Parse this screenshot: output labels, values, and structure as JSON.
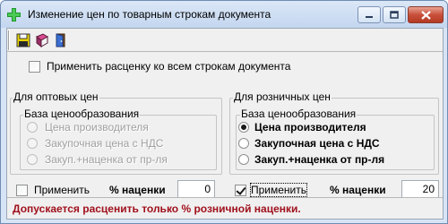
{
  "window": {
    "title": "Изменение цен по товарным строкам документа",
    "colors": {
      "close_button": "#c8503a",
      "status_text": "#a0101c"
    }
  },
  "toolbar": {
    "buttons": [
      {
        "icon": "save-icon"
      },
      {
        "icon": "book-icon"
      },
      {
        "icon": "exit-door-icon"
      }
    ]
  },
  "apply_all": {
    "label": "Применить расценку ко всем строкам документа",
    "checked": false
  },
  "wholesale": {
    "title": "Для оптовых цен",
    "base_title": "База ценообразования",
    "options": [
      "Цена производителя",
      "Закупочная цена с НДС",
      "Закуп.+наценка от пр-ля"
    ],
    "apply_label": "Применить",
    "apply_checked": false,
    "markup_label": "% наценки",
    "markup_value": "0"
  },
  "retail": {
    "title": "Для розничных цен",
    "base_title": "База ценообразования",
    "options": [
      "Цена производителя",
      "Закупочная цена с НДС",
      "Закуп.+наценка от пр-ля"
    ],
    "selected_index": 0,
    "apply_label": "Применить",
    "apply_checked": true,
    "markup_label": "% наценки",
    "markup_value": "20"
  },
  "status": "Допускается расценить только % розничной наценки."
}
